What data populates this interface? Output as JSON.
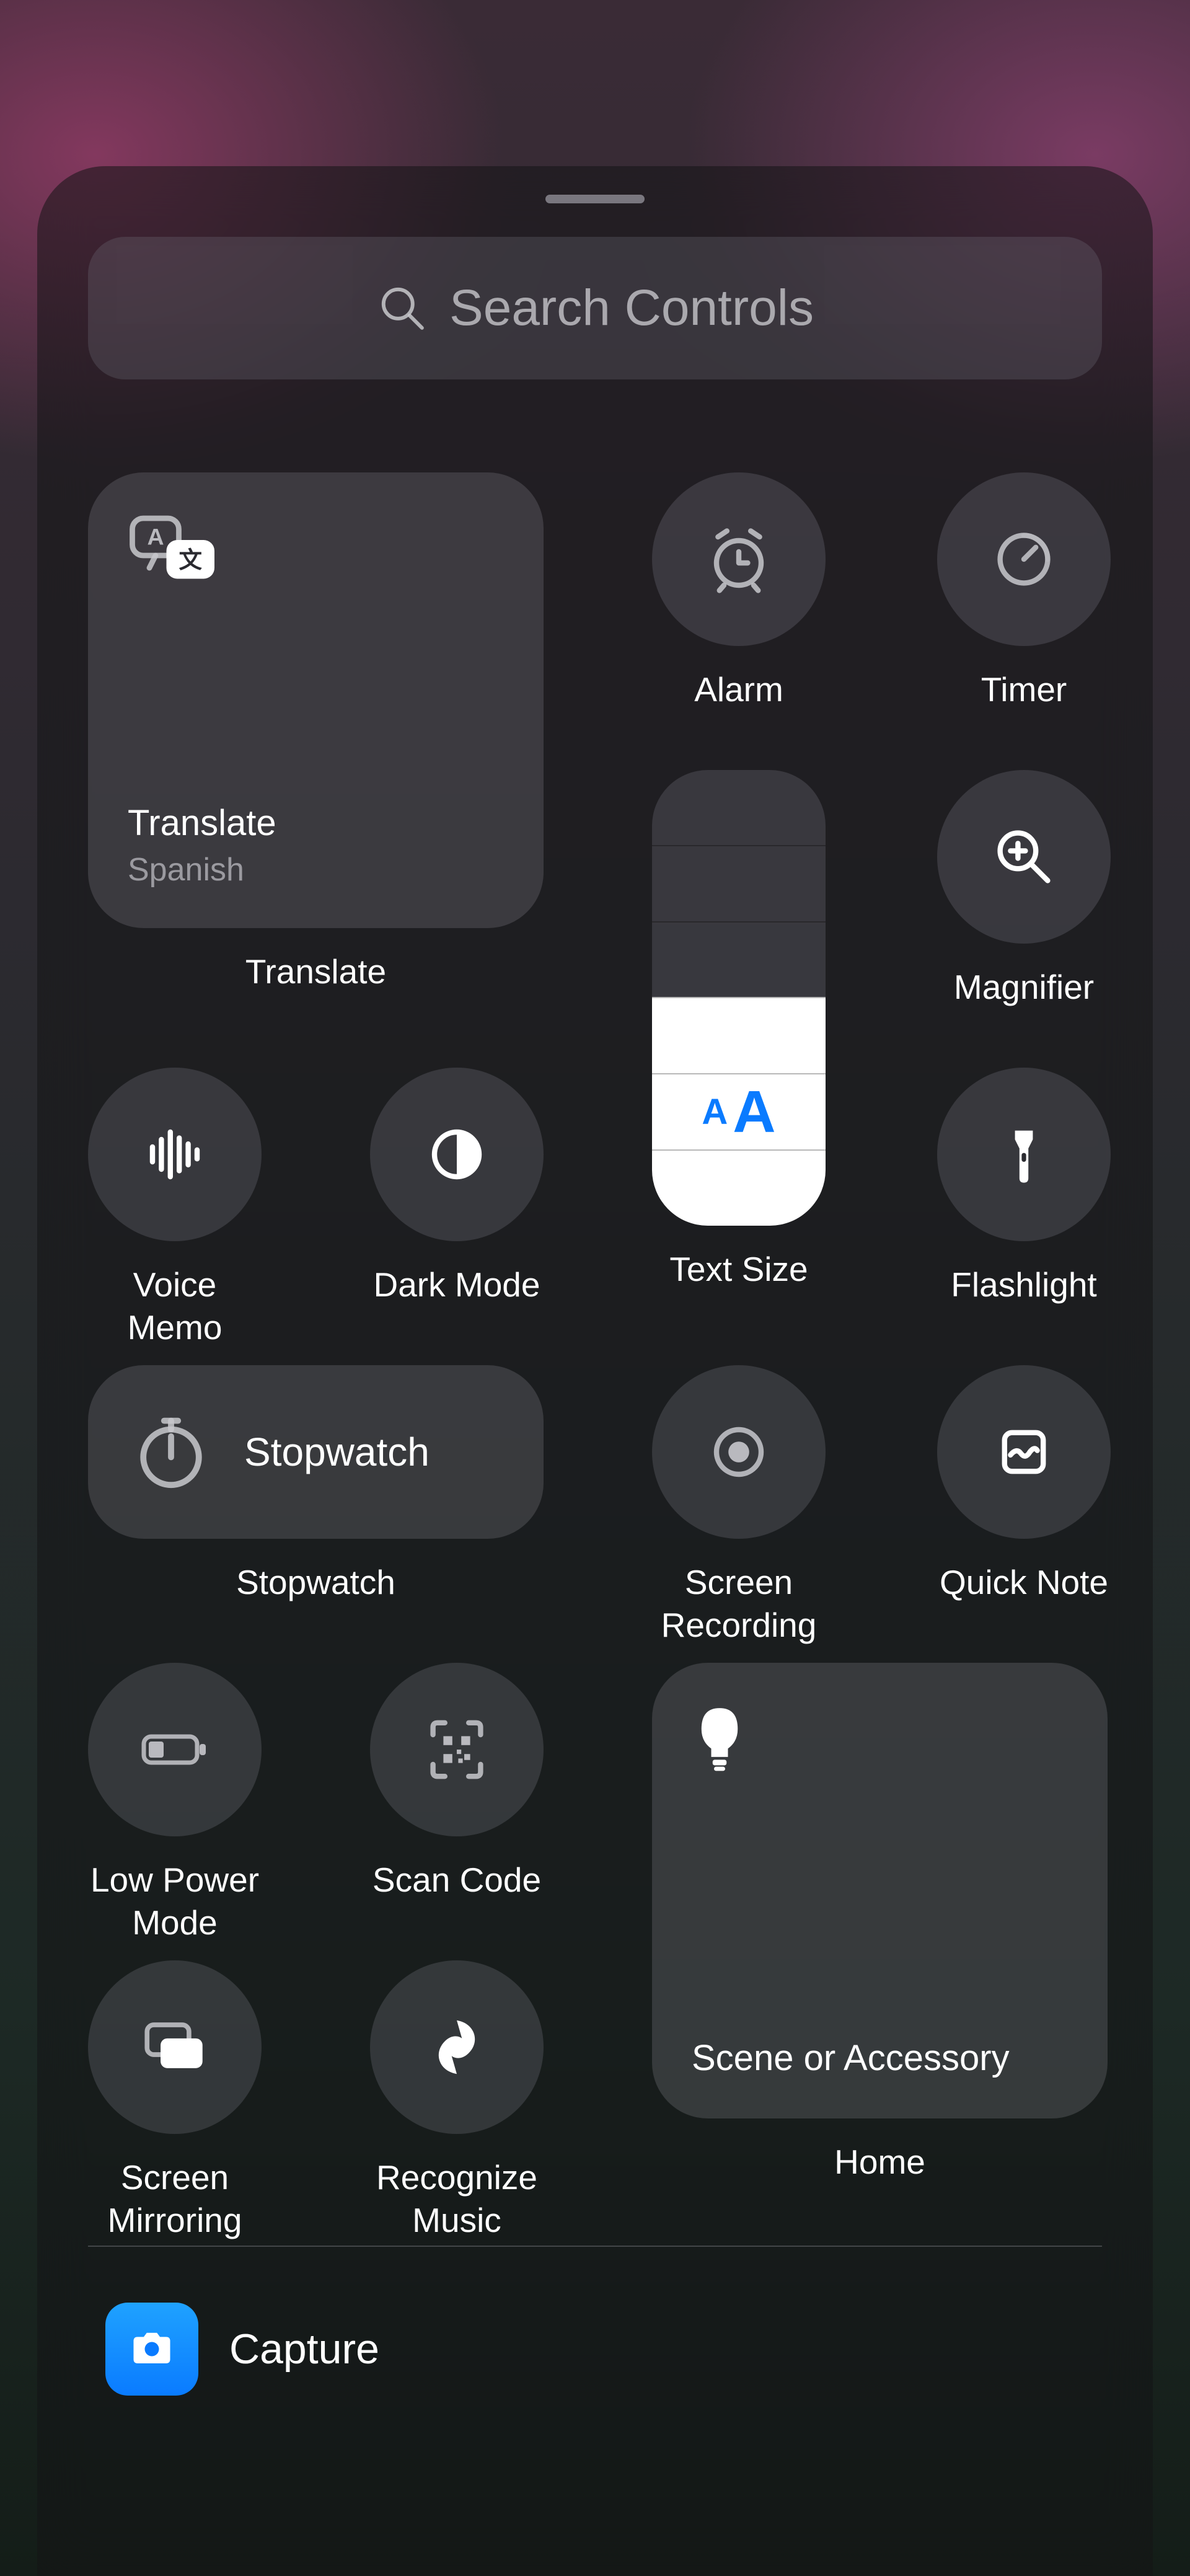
{
  "search": {
    "placeholder": "Search Controls"
  },
  "controls": {
    "translate": {
      "title": "Translate",
      "subtitle": "Spanish",
      "label": "Translate"
    },
    "alarm": {
      "label": "Alarm"
    },
    "timer": {
      "label": "Timer"
    },
    "magnifier": {
      "label": "Magnifier"
    },
    "textsize": {
      "label": "Text Size",
      "steps": 6,
      "value": 3
    },
    "voicememo": {
      "label": "Voice Memo"
    },
    "darkmode": {
      "label": "Dark Mode"
    },
    "flashlight": {
      "label": "Flashlight"
    },
    "stopwatch": {
      "tile_label": "Stopwatch",
      "label": "Stopwatch"
    },
    "screenrecording": {
      "label": "Screen Recording"
    },
    "quicknote": {
      "label": "Quick Note"
    },
    "lowpower": {
      "label": "Low Power Mode"
    },
    "scancode": {
      "label": "Scan Code"
    },
    "screenmirroring": {
      "label": "Screen Mirroring"
    },
    "recognizemusic": {
      "label": "Recognize Music"
    },
    "home": {
      "tile_label": "Scene or Accessory",
      "label": "Home"
    }
  },
  "apps": {
    "capture": {
      "label": "Capture"
    }
  }
}
